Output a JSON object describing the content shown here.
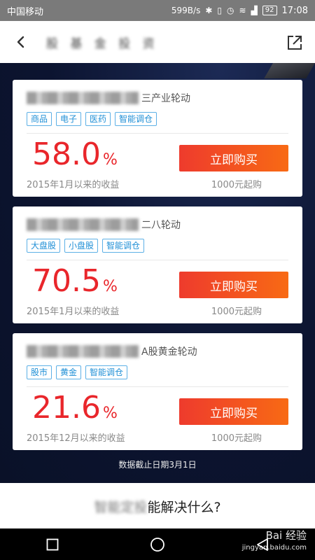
{
  "statusbar": {
    "carrier": "中国移动",
    "speed": "599B/s",
    "battery": "92",
    "time": "17:08"
  },
  "header": {
    "title": "股 基 金 投 资",
    "back_icon": "chevron-left-icon",
    "share_icon": "share-icon"
  },
  "products": [
    {
      "name_suffix": "三产业轮动",
      "tags": [
        "商品",
        "电子",
        "医药",
        "智能调仓"
      ],
      "rate": "58.0",
      "rate_unit": "%",
      "caption": "2015年1月以来的收益",
      "buy_label": "立即购买",
      "min_purchase": "1000元起购"
    },
    {
      "name_suffix": "二八轮动",
      "tags": [
        "大盘股",
        "小盘股",
        "智能调仓"
      ],
      "rate": "70.5",
      "rate_unit": "%",
      "caption": "2015年1月以来的收益",
      "buy_label": "立即购买",
      "min_purchase": "1000元起购"
    },
    {
      "name_suffix": "A股黄金轮动",
      "tags": [
        "股市",
        "黄金",
        "智能调仓"
      ],
      "rate": "21.6",
      "rate_unit": "%",
      "caption": "2015年12月以来的收益",
      "buy_label": "立即购买",
      "min_purchase": "1000元起购"
    }
  ],
  "footnote": "数据截止日期3月1日",
  "section": {
    "heading_blur": "智能定投",
    "heading_rest": "能解决什么?"
  },
  "watermark": {
    "brand": "Bai 经验",
    "url": "jingyan.baidu.com"
  },
  "colors": {
    "accent_red": "#e9262b",
    "tag_blue": "#1f8fd6",
    "background_navy": "#0d1530",
    "button_gradient_start": "#ee3b2d",
    "button_gradient_end": "#f86a14"
  }
}
